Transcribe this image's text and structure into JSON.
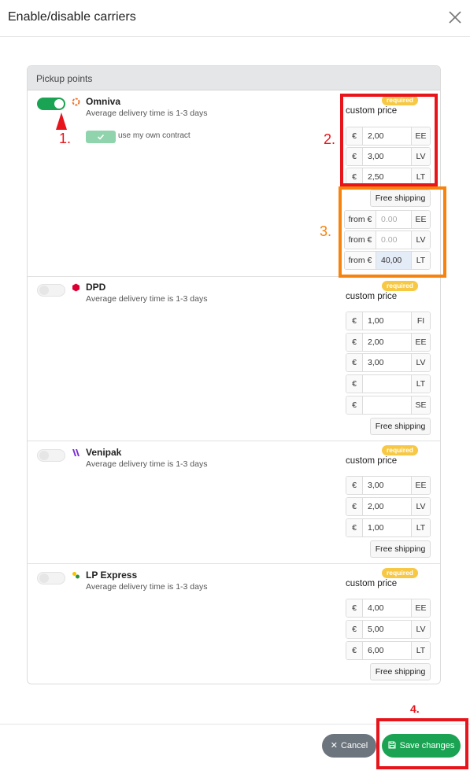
{
  "modal": {
    "title": "Enable/disable carriers"
  },
  "section": {
    "title": "Pickup points"
  },
  "common": {
    "required_badge": "required",
    "custom_price_label": "custom price",
    "currency": "€",
    "from_prefix": "from €",
    "free_shipping_label": "Free shipping",
    "delivery_desc": "Average delivery time is 1-3 days",
    "own_contract_label": "use my own contract"
  },
  "carriers": [
    {
      "name": "Omniva",
      "enabled": true,
      "logo_color": "#f26b21",
      "prices": [
        {
          "value": "2,00",
          "country": "EE"
        },
        {
          "value": "3,00",
          "country": "LV"
        },
        {
          "value": "2,50",
          "country": "LT"
        }
      ],
      "free_shipping": [
        {
          "value": "0.00",
          "country": "EE",
          "placeholder": true
        },
        {
          "value": "0.00",
          "country": "LV",
          "placeholder": true
        },
        {
          "value": "40,00",
          "country": "LT",
          "placeholder": false
        }
      ]
    },
    {
      "name": "DPD",
      "enabled": false,
      "logo_color": "#dc0032",
      "prices": [
        {
          "value": "1,00",
          "country": "FI"
        },
        {
          "value": "2,00",
          "country": "EE"
        },
        {
          "value": "3,00",
          "country": "LV"
        },
        {
          "value": "",
          "country": "LT"
        },
        {
          "value": "",
          "country": "SE"
        }
      ]
    },
    {
      "name": "Venipak",
      "enabled": false,
      "logo_color": "#7b2fd6",
      "prices": [
        {
          "value": "3,00",
          "country": "EE"
        },
        {
          "value": "2,00",
          "country": "LV"
        },
        {
          "value": "1,00",
          "country": "LT"
        }
      ]
    },
    {
      "name": "LP Express",
      "enabled": false,
      "logo_color": "#f4c400",
      "prices": [
        {
          "value": "4,00",
          "country": "EE"
        },
        {
          "value": "5,00",
          "country": "LV"
        },
        {
          "value": "6,00",
          "country": "LT"
        }
      ]
    }
  ],
  "footer": {
    "cancel_label": "Cancel",
    "save_label": "Save changes"
  },
  "annotations": [
    {
      "label": "1.",
      "color": "#e8141b"
    },
    {
      "label": "2.",
      "color": "#e8141b"
    },
    {
      "label": "3.",
      "color": "#f7820c"
    },
    {
      "label": "4.",
      "color": "#e8141b"
    }
  ],
  "colors": {
    "green": "#1aa352",
    "badge_yellow": "#f7c844",
    "annotation_red": "#e8141b",
    "annotation_orange": "#f7820c"
  }
}
